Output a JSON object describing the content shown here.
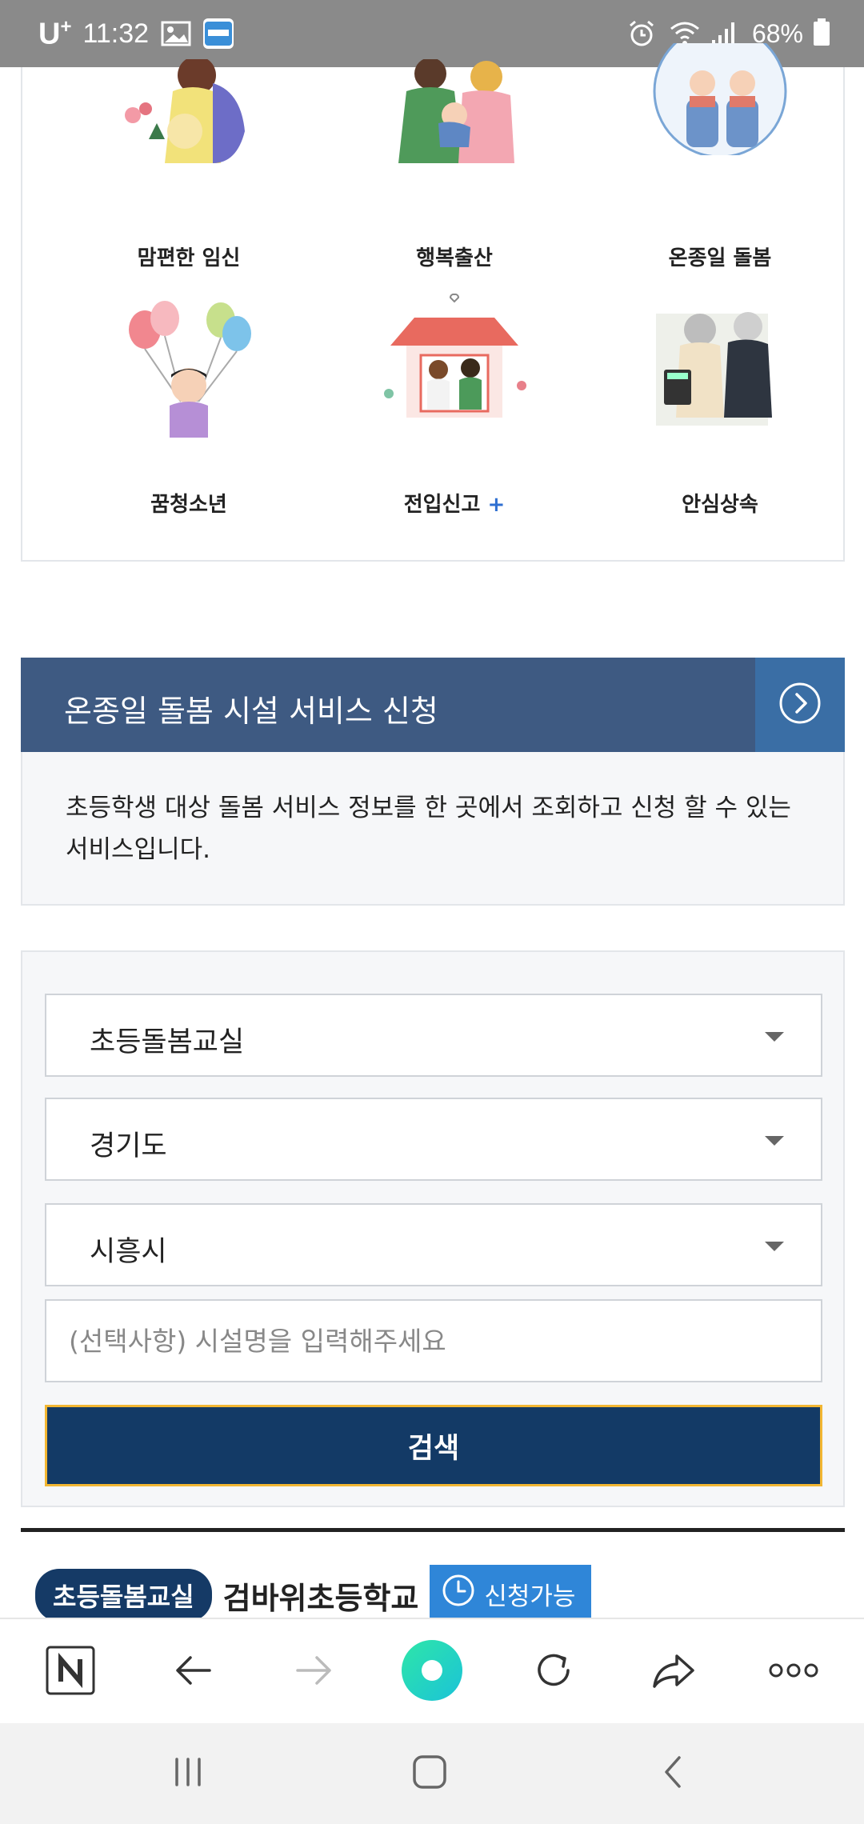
{
  "status_bar": {
    "carrier": "U",
    "carrier_suffix": "+",
    "time": "11:32",
    "battery": "68%"
  },
  "categories": [
    {
      "label": "맘편한 임신",
      "icon": "pregnancy-illustration"
    },
    {
      "label": "행복출산",
      "icon": "birth-family-illustration"
    },
    {
      "label": "온종일 돌봄",
      "icon": "all-day-care-illustration",
      "selected": true
    },
    {
      "label": "꿈청소년",
      "icon": "youth-balloons-illustration"
    },
    {
      "label": "전입신고",
      "icon": "move-in-house-illustration",
      "suffix": "+"
    },
    {
      "label": "안심상속",
      "icon": "inheritance-elderly-illustration"
    }
  ],
  "service": {
    "title": "온종일 돌봄 시설 서비스 신청",
    "description": "초등학생 대상 돌봄 서비스 정보를 한 곳에서 조회하고 신청 할 수 있는 서비스입니다."
  },
  "form": {
    "facility_type": "초등돌봄교실",
    "province": "경기도",
    "city": "시흥시",
    "name_placeholder": "(선택사항) 시설명을 입력해주세요",
    "search_label": "검색"
  },
  "result": {
    "type_badge": "초등돌봄교실",
    "school_name": "검바위초등학교",
    "status": "신청가능"
  },
  "colors": {
    "header_blue": "#3e5a82",
    "button_navy": "#133a66",
    "button_border": "#f2b632",
    "status_blue": "#2f86d8"
  }
}
